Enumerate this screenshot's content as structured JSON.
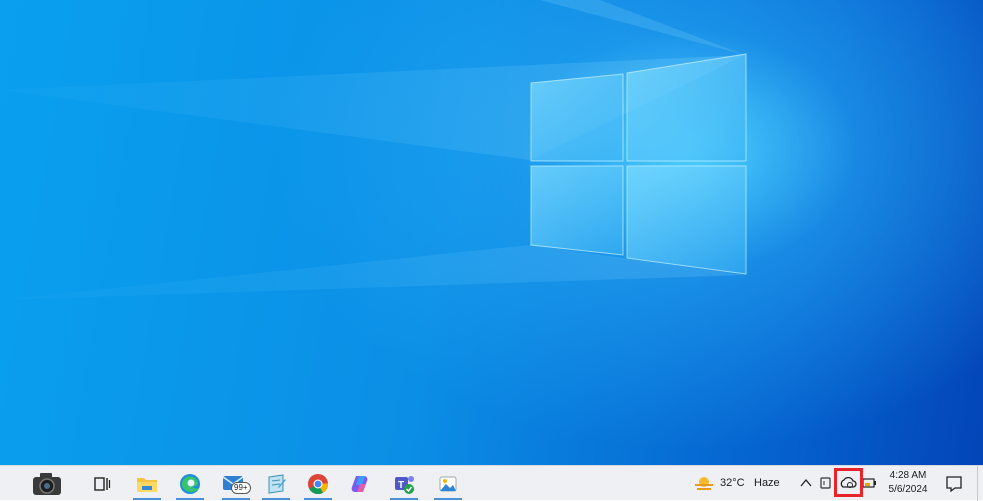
{
  "taskbar": {
    "apps": [
      {
        "name": "camera",
        "icon": "camera-icon"
      },
      {
        "name": "task-view",
        "icon": "task-view-icon"
      },
      {
        "name": "file-explorer",
        "icon": "folder-icon"
      },
      {
        "name": "edge",
        "icon": "edge-icon"
      },
      {
        "name": "mail",
        "icon": "mail-icon",
        "badge": "99+"
      },
      {
        "name": "notepad",
        "icon": "notepad-icon"
      },
      {
        "name": "chrome",
        "icon": "chrome-icon"
      },
      {
        "name": "copilot",
        "icon": "copilot-icon"
      },
      {
        "name": "teams",
        "icon": "teams-icon"
      },
      {
        "name": "photos",
        "icon": "photos-icon"
      }
    ],
    "weather": {
      "temperature": "32°C",
      "condition": "Haze"
    },
    "clock": {
      "time": "4:28 AM",
      "date": "5/6/2024"
    }
  },
  "colors": {
    "accent": "#4a90d9",
    "highlight": "#e8232a",
    "taskbar_bg": "#eef0f3"
  }
}
